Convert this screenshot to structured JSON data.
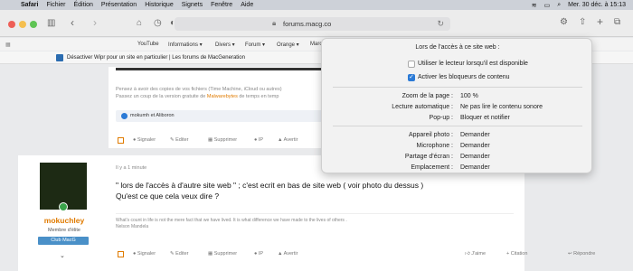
{
  "menubar": {
    "apple": "",
    "app": "Safari",
    "items": [
      "Fichier",
      "Édition",
      "Présentation",
      "Historique",
      "Signets",
      "Fenêtre",
      "Aide"
    ],
    "datetime": "Mer. 30 déc. à 15:13"
  },
  "toolbar": {
    "url": "forums.macg.co"
  },
  "favorites": [
    "YouTube",
    "Informations ▾",
    "Divers ▾",
    "Forum ▾",
    "Orange ▾",
    "Marc"
  ],
  "infobar": {
    "text": "Désactiver Wipr pour un site en particulier | Les forums de MacGeneration"
  },
  "post1": {
    "line1": "Pensez à avoir des copies de vos fichiers (Time Machine, iCloud ou autres)",
    "line2_a": "Passez un coup de la version gratuite de ",
    "line2_link": "Malwarebytes",
    "line2_b": " de temps en temp",
    "reactions": "mokumh et Aliboron",
    "actions": [
      "Signaler",
      "Editer",
      "Supprimer",
      "IP",
      "Avertir"
    ]
  },
  "post2": {
    "author": "mokuchley",
    "role": "Membre d'élite",
    "club": "Club MacG",
    "time": "Il y a 1 minute",
    "text1": "\" lors de l'accès à d'autre site web \" ; c'est ecrit en bas de site web ( voir photo du dessus )",
    "text2": "Qu'est ce que cela veux dire ?",
    "sig1": "What's count in life is not the mere fact that we have lived. It is what difference we have made to the lives of others .",
    "sig2": "Nelson Mandela",
    "actions": [
      "Signaler",
      "Editer",
      "Supprimer",
      "IP",
      "Avertir"
    ],
    "right_actions": [
      "J'aime",
      "+ Citation",
      "Répondre"
    ]
  },
  "popover": {
    "heading": "Lors de l'accès à ce site web :",
    "option1": "Utiliser le lecteur lorsqu'il est disponible",
    "option1_checked": false,
    "option2": "Activer les bloqueurs de contenu",
    "option2_checked": true,
    "settings1": [
      {
        "label": "Zoom de la page :",
        "value": "100 %"
      },
      {
        "label": "Lecture automatique :",
        "value": "Ne pas lire le contenu sonore"
      },
      {
        "label": "Pop-up :",
        "value": "Bloquer et notifier"
      }
    ],
    "settings2": [
      {
        "label": "Appareil photo :",
        "value": "Demander"
      },
      {
        "label": "Microphone :",
        "value": "Demander"
      },
      {
        "label": "Partage d'écran :",
        "value": "Demander"
      },
      {
        "label": "Emplacement :",
        "value": "Demander"
      }
    ]
  },
  "colors": {
    "accent": "#e07b00",
    "blue": "#2b7ad6"
  }
}
